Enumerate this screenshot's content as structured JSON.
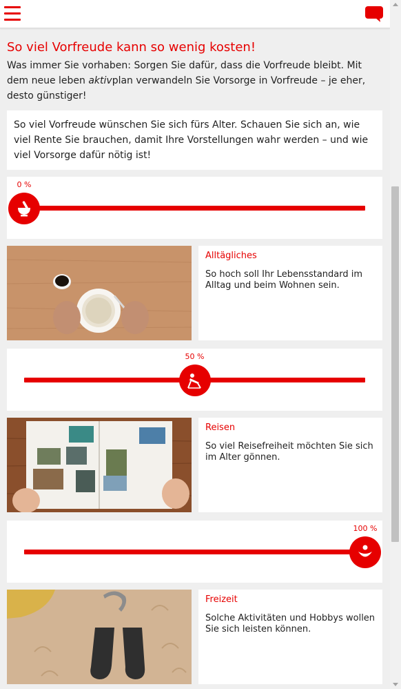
{
  "header": {
    "menu_icon": "hamburger-menu-icon",
    "chat_icon": "chat-bubble-icon"
  },
  "intro": {
    "headline": "So viel Vorfreude kann so wenig kosten!",
    "text_before": "Was immer Sie vorhaben: Sorgen Sie dafür, dass die Vorfreude bleibt. Mit dem neue leben ",
    "text_emphasis": "aktiv",
    "text_after": "plan verwandeln Sie Vorsorge in Vorfreude – je eher, desto günstiger!"
  },
  "info_box": {
    "text": "So viel Vorfreude wünschen Sie sich fürs Alter. Schauen Sie sich an, wie viel Rente Sie brauchen, damit Ihre Vorstellungen wahr werden – und wie viel Vorsorge dafür nötig ist!"
  },
  "sliders": [
    {
      "value_label": "0 %",
      "value_fraction": 0.0,
      "icon": "mortar-pestle-icon"
    },
    {
      "value_label": "50 %",
      "value_fraction": 0.5,
      "icon": "deck-chair-icon"
    },
    {
      "value_label": "100 %",
      "value_fraction": 1.0,
      "icon": "happy-person-icon"
    }
  ],
  "sections": [
    {
      "title": "Alltägliches",
      "description": "So hoch soll Ihr Lebensstandard im Alltag und beim Wohnen sein.",
      "image": "breakfast-table-photo"
    },
    {
      "title": "Reisen",
      "description": "So viel Reisefreiheit möchten Sie sich im Alter gönnen.",
      "image": "photo-album-photo"
    },
    {
      "title": "Freizeit",
      "description": "Solche Aktivitäten und Hobbys wollen Sie sich leisten können.",
      "image": "riding-boots-horseshoe-photo"
    }
  ],
  "colors": {
    "accent": "#e60000",
    "background": "#efefef",
    "card": "#ffffff"
  }
}
